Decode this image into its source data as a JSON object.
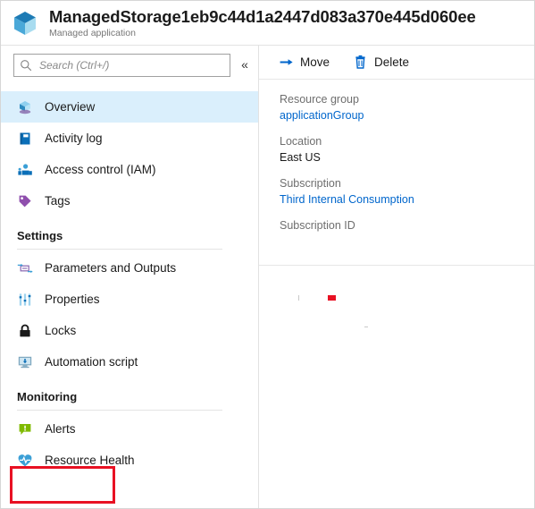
{
  "header": {
    "icon": "managed-application-cube-icon",
    "title": "ManagedStorage1eb9c44d1a2447d083a370e445d060ee",
    "subtitle": "Managed application"
  },
  "sidebar": {
    "search": {
      "placeholder": "Search (Ctrl+/)",
      "value": "",
      "icon": "search-icon"
    },
    "collapse": {
      "label": "«",
      "icon": "chevron-double-left-icon"
    },
    "items": [
      {
        "label": "Overview",
        "icon": "overview-cube-icon",
        "selected": true
      },
      {
        "label": "Activity log",
        "icon": "activity-log-book-icon",
        "selected": false
      },
      {
        "label": "Access control (IAM)",
        "icon": "access-control-people-icon",
        "selected": false
      },
      {
        "label": "Tags",
        "icon": "tags-icon",
        "selected": false
      }
    ],
    "groups": [
      {
        "title": "Settings",
        "items": [
          {
            "label": "Parameters and Outputs",
            "icon": "parameters-outputs-icon",
            "selected": false
          },
          {
            "label": "Properties",
            "icon": "properties-sliders-icon",
            "selected": false
          },
          {
            "label": "Locks",
            "icon": "locks-padlock-icon",
            "selected": false
          },
          {
            "label": "Automation script",
            "icon": "automation-script-monitor-icon",
            "selected": false
          }
        ]
      },
      {
        "title": "Monitoring",
        "items": [
          {
            "label": "Alerts",
            "icon": "alerts-bubble-icon",
            "selected": false,
            "highlighted": true
          },
          {
            "label": "Resource Health",
            "icon": "resource-health-heart-icon",
            "selected": false
          }
        ]
      }
    ]
  },
  "toolbar": {
    "buttons": [
      {
        "label": "Move",
        "icon": "move-arrow-icon"
      },
      {
        "label": "Delete",
        "icon": "delete-trash-icon"
      }
    ]
  },
  "properties": [
    {
      "label": "Resource group",
      "value": "applicationGroup",
      "is_link": true
    },
    {
      "label": "Location",
      "value": "East US",
      "is_link": false
    },
    {
      "label": "Subscription",
      "value": "Third Internal Consumption",
      "is_link": true
    },
    {
      "label": "Subscription ID",
      "value": "",
      "is_link": false
    }
  ],
  "colors": {
    "accent_link": "#0066cc",
    "selected_row": "#daeffc",
    "annotation_red": "#e81123",
    "label_gray": "#6e6e6e",
    "border": "#e2e2e2"
  }
}
